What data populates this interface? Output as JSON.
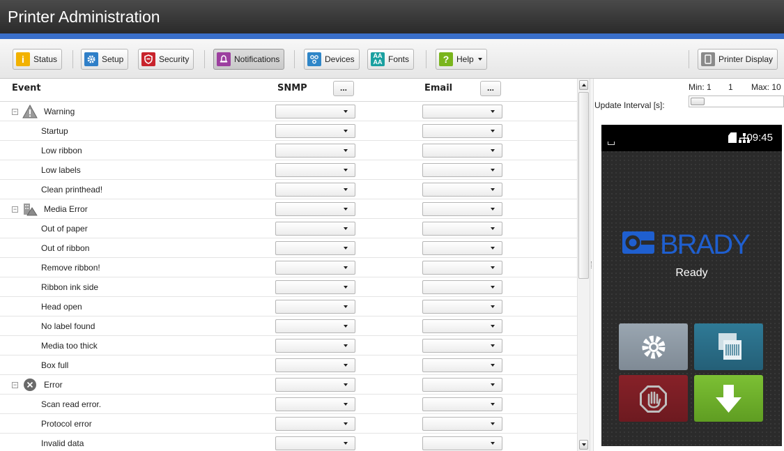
{
  "app": {
    "title": "Printer Administration"
  },
  "toolbar": {
    "buttons": [
      {
        "label": "Status",
        "icon": "info-icon",
        "color": "#f2b200"
      },
      {
        "label": "Setup",
        "icon": "gear-icon",
        "color": "#2f7fc8"
      },
      {
        "label": "Security",
        "icon": "shield-icon",
        "color": "#c8232c"
      },
      {
        "label": "Notifications",
        "icon": "bell-icon",
        "color": "#9c3f9f",
        "active": true
      },
      {
        "label": "Devices",
        "icon": "devices-icon",
        "color": "#2f86c8"
      },
      {
        "label": "Fonts",
        "icon": "fonts-icon",
        "color": "#1aa0a0"
      },
      {
        "label": "Help",
        "icon": "help-icon",
        "color": "#7ab51d"
      },
      {
        "label": "Printer Display",
        "icon": "display-icon",
        "color": "#8a8a8a"
      }
    ]
  },
  "table": {
    "headers": {
      "event": "Event",
      "snmp": "SNMP",
      "email": "Email",
      "more": "..."
    },
    "rows": [
      {
        "type": "group",
        "label": "Warning",
        "icon": "warning-icon"
      },
      {
        "type": "item",
        "label": "Startup"
      },
      {
        "type": "item",
        "label": "Low ribbon"
      },
      {
        "type": "item",
        "label": "Low labels"
      },
      {
        "type": "item",
        "label": "Clean printhead!"
      },
      {
        "type": "group",
        "label": "Media Error",
        "icon": "media-error-icon"
      },
      {
        "type": "item",
        "label": "Out of paper"
      },
      {
        "type": "item",
        "label": "Out of ribbon"
      },
      {
        "type": "item",
        "label": "Remove ribbon!"
      },
      {
        "type": "item",
        "label": "Ribbon ink side"
      },
      {
        "type": "item",
        "label": "Head open"
      },
      {
        "type": "item",
        "label": "No label found"
      },
      {
        "type": "item",
        "label": "Media too thick"
      },
      {
        "type": "item",
        "label": "Box full"
      },
      {
        "type": "group",
        "label": "Error",
        "icon": "error-icon"
      },
      {
        "type": "item",
        "label": "Scan read error."
      },
      {
        "type": "item",
        "label": "Protocol error"
      },
      {
        "type": "item",
        "label": "Invalid data"
      }
    ]
  },
  "update_interval": {
    "label": "Update Interval [s]:",
    "min_label": "Min: 1",
    "value": "1",
    "max_label": "Max: 10"
  },
  "display": {
    "time": "09:45",
    "brand": "BRADY",
    "status": "Ready",
    "colors": {
      "brand": "#1f5fcf",
      "settings_tile": "#8e9aa6",
      "feed_tile": "#2a6f8a",
      "stop_tile": "#7d1f25",
      "ok_tile": "#6fb12a"
    }
  }
}
